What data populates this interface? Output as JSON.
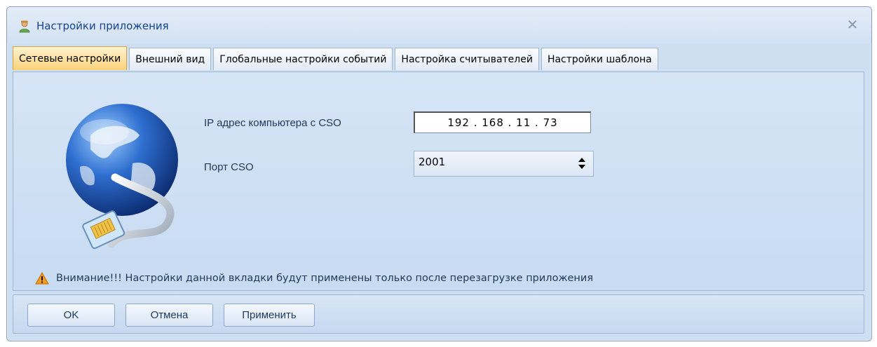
{
  "window": {
    "title": "Настройки приложения",
    "close_glyph": "✕"
  },
  "tabs": [
    {
      "label": "Сетевые настройки",
      "active": true
    },
    {
      "label": "Внешний вид",
      "active": false
    },
    {
      "label": "Глобальные настройки событий",
      "active": false
    },
    {
      "label": "Настройка считывателей",
      "active": false
    },
    {
      "label": "Настройки шаблона",
      "active": false
    }
  ],
  "network": {
    "ip_label": "IP адрес компьютера с CSO",
    "ip_value": "192 . 168 . 11 . 73",
    "port_label": "Порт CSO",
    "port_value": "2001"
  },
  "warning": {
    "text": "Внимание!!! Настройки данной вкладки будут применены только после перезагрузке приложения"
  },
  "buttons": {
    "ok": "OK",
    "cancel": "Отмена",
    "apply": "Применить"
  },
  "icons": {
    "title": "user-icon",
    "illustration": "globe-network-cable-icon",
    "warning": "warning-triangle-icon",
    "spinner": "up-down-arrows-icon"
  },
  "colors": {
    "active_tab": "#fbd27a",
    "panel": "#cfdff2",
    "title_text": "#15428b"
  }
}
